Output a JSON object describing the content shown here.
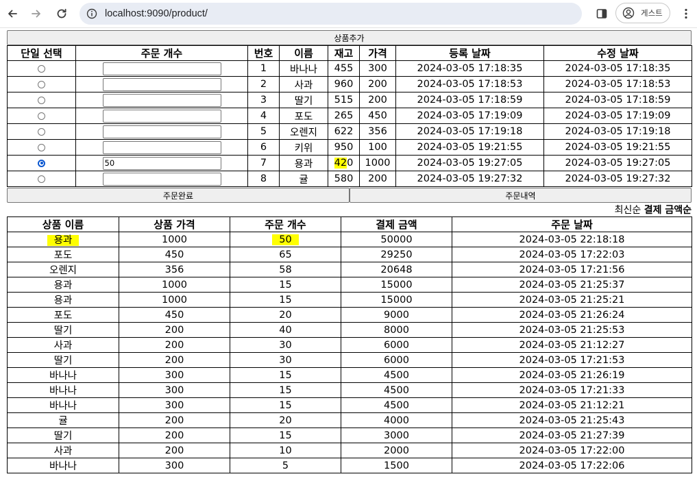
{
  "browser": {
    "url": "localhost:9090/product/",
    "profile_label": "게스트"
  },
  "buttons": {
    "add_product": "상품추가",
    "order_complete": "주문완료",
    "order_history": "주문내역"
  },
  "product_table": {
    "headers": [
      "단일 선택",
      "주문 개수",
      "번호",
      "이름",
      "재고",
      "가격",
      "등록 날짜",
      "수정 날짜"
    ],
    "rows": [
      {
        "selected": false,
        "qty": "",
        "no": "1",
        "name": "바나나",
        "stock": "455",
        "price": "300",
        "created": "2024-03-05 17:18:35",
        "updated": "2024-03-05 17:18:35"
      },
      {
        "selected": false,
        "qty": "",
        "no": "2",
        "name": "사과",
        "stock": "960",
        "price": "200",
        "created": "2024-03-05 17:18:53",
        "updated": "2024-03-05 17:18:53"
      },
      {
        "selected": false,
        "qty": "",
        "no": "3",
        "name": "딸기",
        "stock": "515",
        "price": "200",
        "created": "2024-03-05 17:18:59",
        "updated": "2024-03-05 17:18:59"
      },
      {
        "selected": false,
        "qty": "",
        "no": "4",
        "name": "포도",
        "stock": "265",
        "price": "450",
        "created": "2024-03-05 17:19:09",
        "updated": "2024-03-05 17:19:09"
      },
      {
        "selected": false,
        "qty": "",
        "no": "5",
        "name": "오렌지",
        "stock": "622",
        "price": "356",
        "created": "2024-03-05 17:19:18",
        "updated": "2024-03-05 17:19:18"
      },
      {
        "selected": false,
        "qty": "",
        "no": "6",
        "name": "키위",
        "stock": "950",
        "price": "100",
        "created": "2024-03-05 19:21:55",
        "updated": "2024-03-05 19:21:55"
      },
      {
        "selected": true,
        "qty": "50",
        "no": "7",
        "name": "용과",
        "stock": "420",
        "price": "1000",
        "created": "2024-03-05 19:27:05",
        "updated": "2024-03-05 19:27:05"
      },
      {
        "selected": false,
        "qty": "",
        "no": "8",
        "name": "귤",
        "stock": "580",
        "price": "200",
        "created": "2024-03-05 19:27:32",
        "updated": "2024-03-05 19:27:32"
      }
    ]
  },
  "sort": {
    "latest": "최신순",
    "by_amount": "결제 금액순"
  },
  "order_table": {
    "headers": [
      "상품 이름",
      "상품 가격",
      "주문 개수",
      "결제 금액",
      "주문 날짜"
    ],
    "rows": [
      {
        "name": "용과",
        "price": "1000",
        "qty": "50",
        "amount": "50000",
        "date": "2024-03-05 22:18:18",
        "highlight": true
      },
      {
        "name": "포도",
        "price": "450",
        "qty": "65",
        "amount": "29250",
        "date": "2024-03-05 17:22:03"
      },
      {
        "name": "오렌지",
        "price": "356",
        "qty": "58",
        "amount": "20648",
        "date": "2024-03-05 17:21:56"
      },
      {
        "name": "용과",
        "price": "1000",
        "qty": "15",
        "amount": "15000",
        "date": "2024-03-05 21:25:37"
      },
      {
        "name": "용과",
        "price": "1000",
        "qty": "15",
        "amount": "15000",
        "date": "2024-03-05 21:25:21"
      },
      {
        "name": "포도",
        "price": "450",
        "qty": "20",
        "amount": "9000",
        "date": "2024-03-05 21:26:24"
      },
      {
        "name": "딸기",
        "price": "200",
        "qty": "40",
        "amount": "8000",
        "date": "2024-03-05 21:25:53"
      },
      {
        "name": "사과",
        "price": "200",
        "qty": "30",
        "amount": "6000",
        "date": "2024-03-05 21:12:27"
      },
      {
        "name": "딸기",
        "price": "200",
        "qty": "30",
        "amount": "6000",
        "date": "2024-03-05 17:21:53"
      },
      {
        "name": "바나나",
        "price": "300",
        "qty": "15",
        "amount": "4500",
        "date": "2024-03-05 21:26:19"
      },
      {
        "name": "바나나",
        "price": "300",
        "qty": "15",
        "amount": "4500",
        "date": "2024-03-05 17:21:33"
      },
      {
        "name": "바나나",
        "price": "300",
        "qty": "15",
        "amount": "4500",
        "date": "2024-03-05 21:12:21"
      },
      {
        "name": "귤",
        "price": "200",
        "qty": "20",
        "amount": "4000",
        "date": "2024-03-05 21:25:43"
      },
      {
        "name": "딸기",
        "price": "200",
        "qty": "15",
        "amount": "3000",
        "date": "2024-03-05 21:27:39"
      },
      {
        "name": "사과",
        "price": "200",
        "qty": "10",
        "amount": "2000",
        "date": "2024-03-05 17:22:00"
      },
      {
        "name": "바나나",
        "price": "300",
        "qty": "5",
        "amount": "1500",
        "date": "2024-03-05 17:22:06"
      }
    ]
  },
  "colors": {
    "highlight": "#ffff00",
    "radio_selected": "#0b57d0",
    "omnibox_bg": "#e8ecf4"
  }
}
